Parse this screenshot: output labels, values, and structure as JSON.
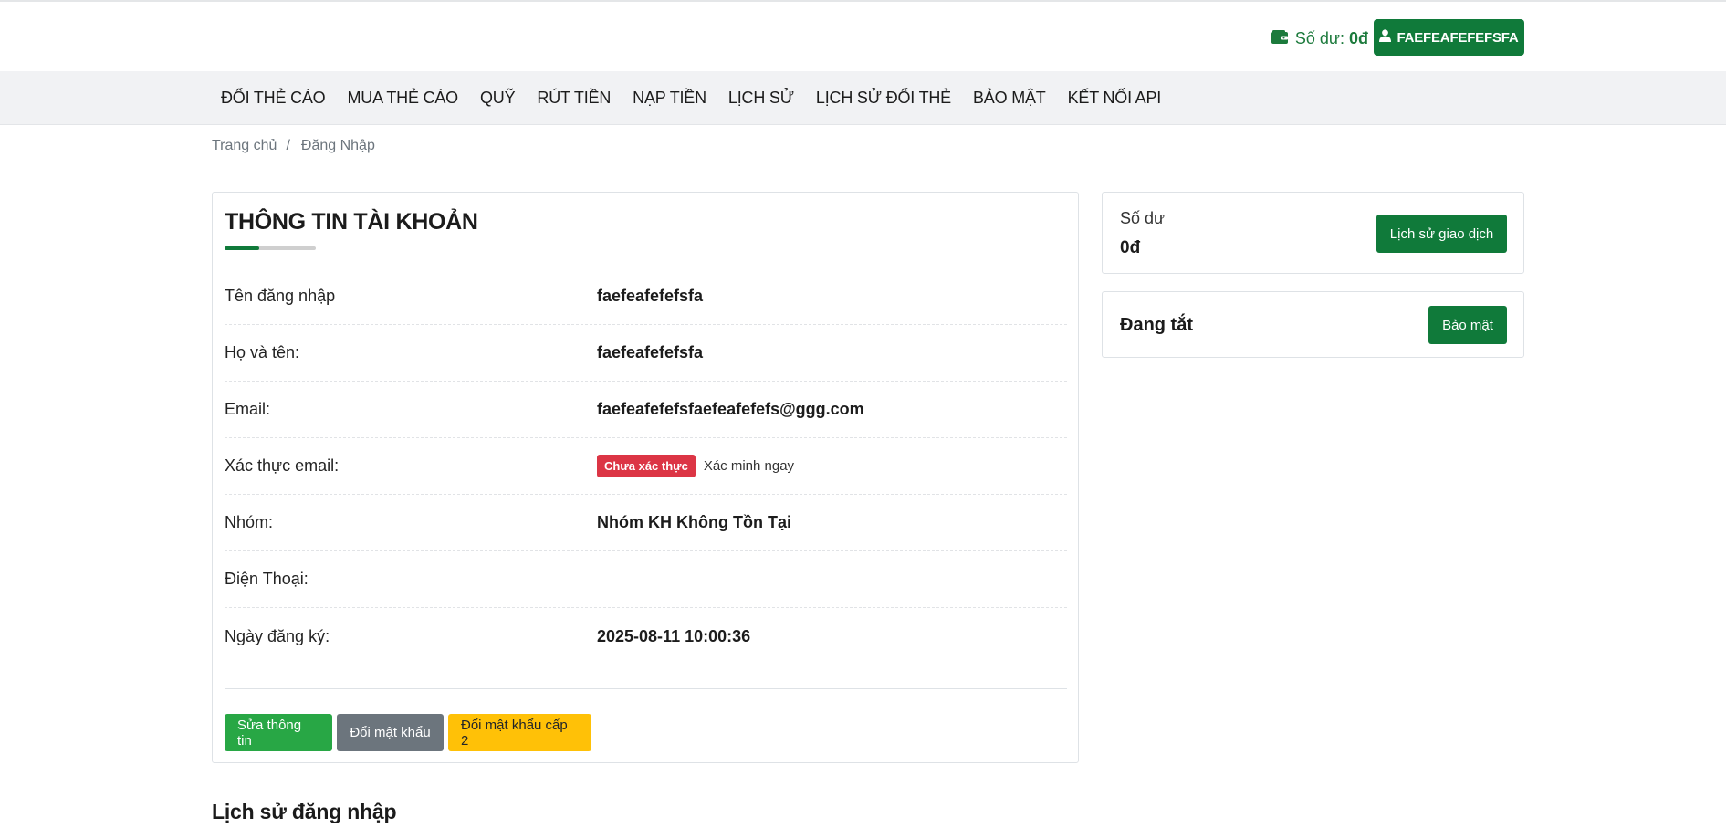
{
  "header": {
    "balance_label": "Số dư:",
    "balance_amount": "0đ",
    "username_button": "FAEFEAFEFEFSFA",
    "accent_color": "#107a3a"
  },
  "nav": {
    "items": [
      {
        "label": "ĐỔI THẺ CÀO"
      },
      {
        "label": "MUA THẺ CÀO"
      },
      {
        "label": "QUỸ"
      },
      {
        "label": "RÚT TIỀN"
      },
      {
        "label": "NẠP TIỀN"
      },
      {
        "label": "LỊCH SỬ"
      },
      {
        "label": "LỊCH SỬ ĐỔI THẺ"
      },
      {
        "label": "BẢO MẬT"
      },
      {
        "label": "KẾT NỐI API"
      }
    ]
  },
  "breadcrumb": {
    "home": "Trang chủ",
    "separator": "/",
    "current": "Đăng Nhập"
  },
  "account": {
    "title": "THÔNG TIN TÀI KHOẢN",
    "rows": [
      {
        "label": "Tên đăng nhập",
        "value": "faefeafefefsfa"
      },
      {
        "label": "Họ và tên:",
        "value": "faefeafefefsfa"
      },
      {
        "label": "Email:",
        "value": "faefeafefefsfaefeafefefs@ggg.com"
      },
      {
        "label": "Xác thực email:",
        "badge": "Chưa xác thực",
        "link": "Xác minh ngay"
      },
      {
        "label": "Nhóm:",
        "value": "Nhóm KH Không Tồn Tại"
      },
      {
        "label": "Điện Thoại:",
        "value": ""
      },
      {
        "label": "Ngày đăng ký:",
        "value": "2025-08-11 10:00:36"
      }
    ],
    "buttons": {
      "edit": "Sửa thông tin",
      "change_password": "Đổi mật khẩu",
      "change_password_2": "Đổi mật khẩu cấp 2"
    }
  },
  "side": {
    "balance_label": "Số dư",
    "balance_amount": "0đ",
    "history_button": "Lịch sử giao dịch",
    "security_status": "Đang tắt",
    "security_button": "Bảo mật"
  },
  "login_history": {
    "title": "Lịch sử đăng nhập"
  }
}
